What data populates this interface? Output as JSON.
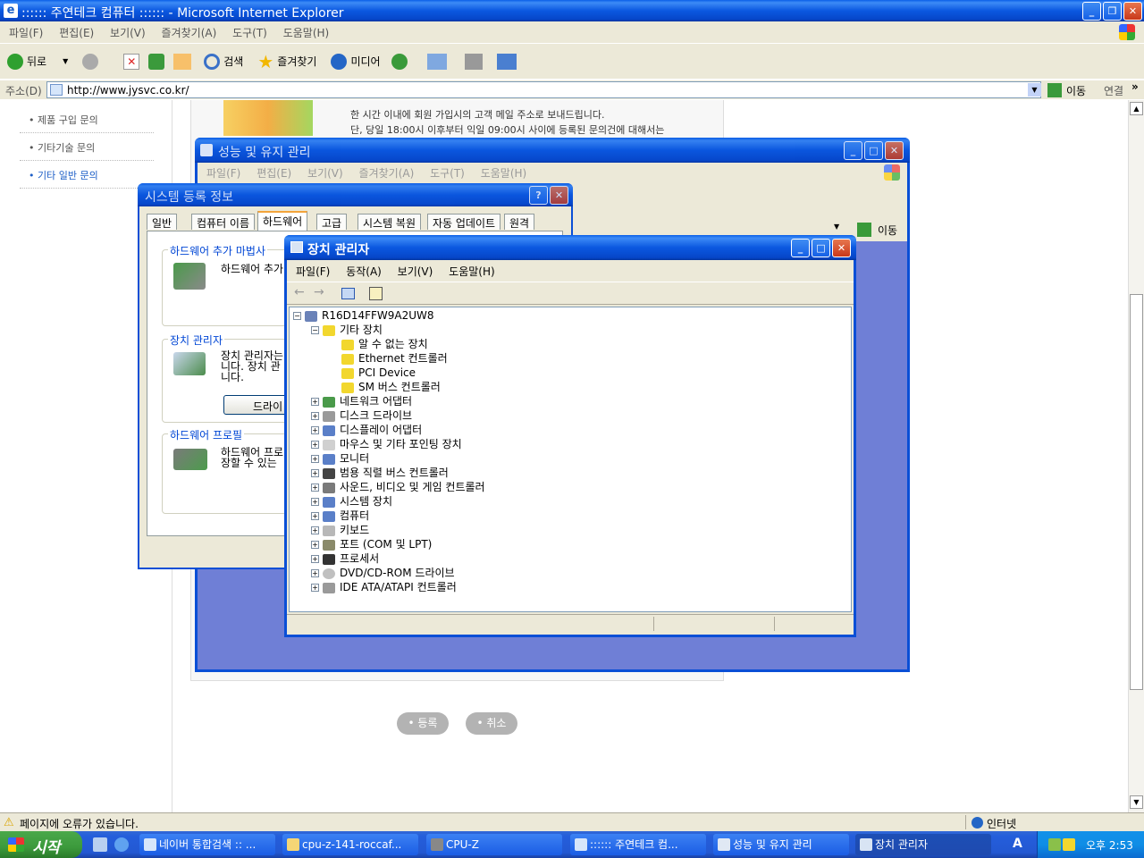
{
  "ie": {
    "title": ":::::: 주연테크 컴퓨터 :::::: - Microsoft Internet Explorer",
    "menu": [
      "파일(F)",
      "편집(E)",
      "보기(V)",
      "즐겨찾기(A)",
      "도구(T)",
      "도움말(H)"
    ],
    "toolbar": {
      "back": "뒤로",
      "search": "검색",
      "favorites": "즐겨찾기",
      "media": "미디어"
    },
    "address_label": "주소(D)",
    "address_value": "http://www.jysvc.co.kr/",
    "go": "이동",
    "links": "연결",
    "status": "페이지에 오류가 있습니다.",
    "zone": "인터넷"
  },
  "page": {
    "sidebar": [
      "• 제품 구입 문의",
      "• 기타기술 문의",
      "• 기타 일반 문의"
    ],
    "notice": [
      "한 시간 이내에 회원 가입시의 고객 메일 주소로 보내드립니다.",
      "단, 당일 18:00시 이후부터 익일 09:00시 사이에 등록된 문의건에 대해서는"
    ],
    "register": "• 등록",
    "cancel": "• 취소"
  },
  "perf": {
    "title": "성능 및 유지 관리",
    "menu": [
      "파일(F)",
      "편집(E)",
      "보기(V)",
      "즐겨찾기(A)",
      "도구(T)",
      "도움말(H)"
    ],
    "go": "이동"
  },
  "sysprops": {
    "title": "시스템 등록 정보",
    "tabs": [
      "일반",
      "컴퓨터 이름",
      "하드웨어",
      "고급",
      "시스템 복원",
      "자동 업데이트",
      "원격"
    ],
    "wizard_legend": "하드웨어 추가 마법사",
    "wizard_text": "하드웨어 추가",
    "devmgr_legend": "장치 관리자",
    "devmgr_text": [
      "장치 관리자는",
      "니다. 장치 관",
      "니다."
    ],
    "driver_btn": "드라이",
    "profile_legend": "하드웨어 프로필",
    "profile_text": [
      "하드웨어 프로",
      "장할 수 있는"
    ]
  },
  "devmgr": {
    "title": "장치 관리자",
    "menu": [
      "파일(F)",
      "동작(A)",
      "보기(V)",
      "도움말(H)"
    ],
    "root": "R16D14FFW9A2UW8",
    "other": "기타 장치",
    "other_children": [
      "알 수 없는 장치",
      "Ethernet 컨트롤러",
      "PCI Device",
      "SM 버스 컨트롤러"
    ],
    "categories": [
      "네트워크 어댑터",
      "디스크 드라이브",
      "디스플레이 어댑터",
      "마우스 및 기타 포인팅 장치",
      "모니터",
      "범용 직렬 버스 컨트롤러",
      "사운드, 비디오 및 게임 컨트롤러",
      "시스템 장치",
      "컴퓨터",
      "키보드",
      "포트 (COM 및 LPT)",
      "프로세서",
      "DVD/CD-ROM 드라이브",
      "IDE ATA/ATAPI 컨트롤러"
    ]
  },
  "taskbar": {
    "start": "시작",
    "tasks": [
      "네이버 통합검색 :: ...",
      "cpu-z-141-roccaf...",
      "CPU-Z",
      ":::::: 주연테크 컴...",
      "성능 및 유지 관리",
      "장치 관리자"
    ],
    "lang": "A",
    "clock": "오후 2:53"
  },
  "colors": {
    "xp_blue": "#0a5fe8",
    "taskbar": "#245edb",
    "start": "#3c9a3c",
    "perf_bg": "#6f7fd6"
  }
}
